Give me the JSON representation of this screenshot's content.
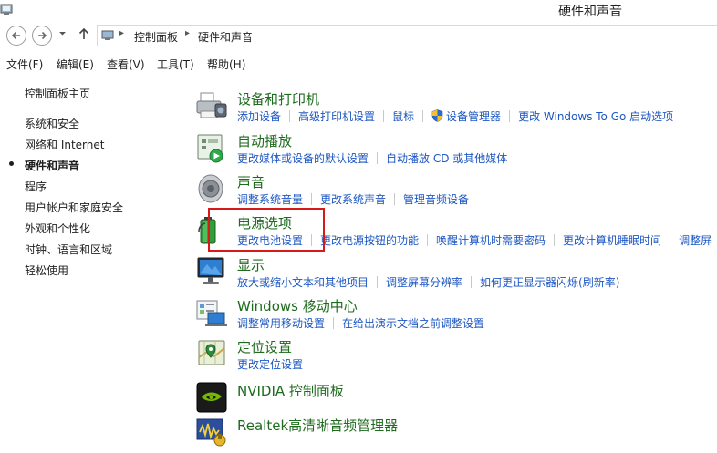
{
  "window": {
    "title": "硬件和声音"
  },
  "address": {
    "crumbs": [
      "控制面板",
      "硬件和声音"
    ]
  },
  "menu": [
    "文件(F)",
    "编辑(E)",
    "查看(V)",
    "工具(T)",
    "帮助(H)"
  ],
  "sidebar": {
    "home": "控制面板主页",
    "items": [
      "系统和安全",
      "网络和 Internet",
      "硬件和声音",
      "程序",
      "用户帐户和家庭安全",
      "外观和个性化",
      "时钟、语言和区域",
      "轻松使用"
    ],
    "current_index": 2
  },
  "categories": [
    {
      "title": "设备和打印机",
      "icon": "printer-icon",
      "links": [
        "添加设备",
        "高级打印机设置",
        "鼠标",
        "设备管理器",
        "更改 Windows To Go 启动选项"
      ]
    },
    {
      "title": "自动播放",
      "icon": "autoplay-icon",
      "links": [
        "更改媒体或设备的默认设置",
        "自动播放 CD 或其他媒体"
      ]
    },
    {
      "title": "声音",
      "icon": "speaker-icon",
      "links": [
        "调整系统音量",
        "更改系统声音",
        "管理音频设备"
      ]
    },
    {
      "title": "电源选项",
      "icon": "battery-icon",
      "links": [
        "更改电池设置",
        "更改电源按钮的功能",
        "唤醒计算机时需要密码",
        "更改计算机睡眠时间",
        "调整屏"
      ]
    },
    {
      "title": "显示",
      "icon": "monitor-icon",
      "links": [
        "放大或缩小文本和其他项目",
        "调整屏幕分辨率",
        "如何更正显示器闪烁(刷新率)"
      ]
    },
    {
      "title": "Windows 移动中心",
      "icon": "mobility-center-icon",
      "links": [
        "调整常用移动设置",
        "在给出演示文档之前调整设置"
      ]
    },
    {
      "title": "定位设置",
      "icon": "location-icon",
      "links": [
        "更改定位设置"
      ]
    },
    {
      "title": "NVIDIA 控制面板",
      "icon": "nvidia-icon",
      "links": []
    },
    {
      "title": "Realtek高清晰音频管理器",
      "icon": "realtek-icon",
      "links": []
    }
  ],
  "colors": {
    "category_title": "#1e6b1e",
    "link": "#1d57c2",
    "highlight": "#d61a1a"
  }
}
